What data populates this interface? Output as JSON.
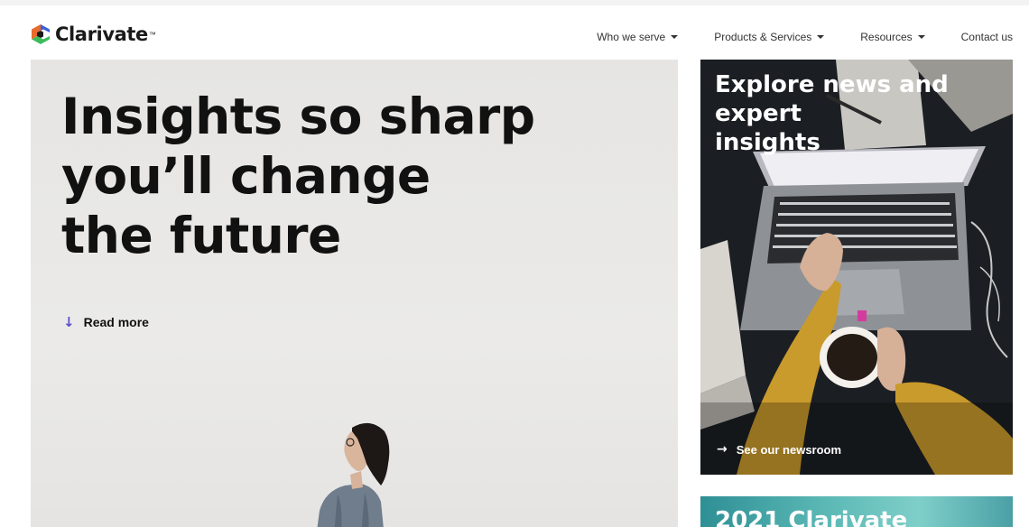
{
  "header": {
    "logo_text": "Clarivate",
    "logo_tm": "™",
    "nav": [
      {
        "label": "Who we serve",
        "has_dropdown": true
      },
      {
        "label": "Products & Services",
        "has_dropdown": true
      },
      {
        "label": "Resources",
        "has_dropdown": true
      },
      {
        "label": "Contact us",
        "has_dropdown": false
      }
    ]
  },
  "hero": {
    "title_lines": [
      "Insights so sharp",
      "you’ll change",
      "the future"
    ],
    "read_more_label": "Read more",
    "read_more_icon": "arrow-down-icon"
  },
  "news_card": {
    "title_lines": [
      "Explore news and expert",
      "insights"
    ],
    "link_label": "See our newsroom",
    "link_icon": "arrow-right-icon"
  },
  "second_card": {
    "title": "2021 Clarivate"
  },
  "colors": {
    "accent": "#5b4fc9",
    "hero_bg": "#e9e8e6",
    "card_bg": "#1e2226",
    "logo_green": "#3dbb5a",
    "logo_orange": "#e86a2c",
    "logo_blue": "#3b5fd6"
  }
}
